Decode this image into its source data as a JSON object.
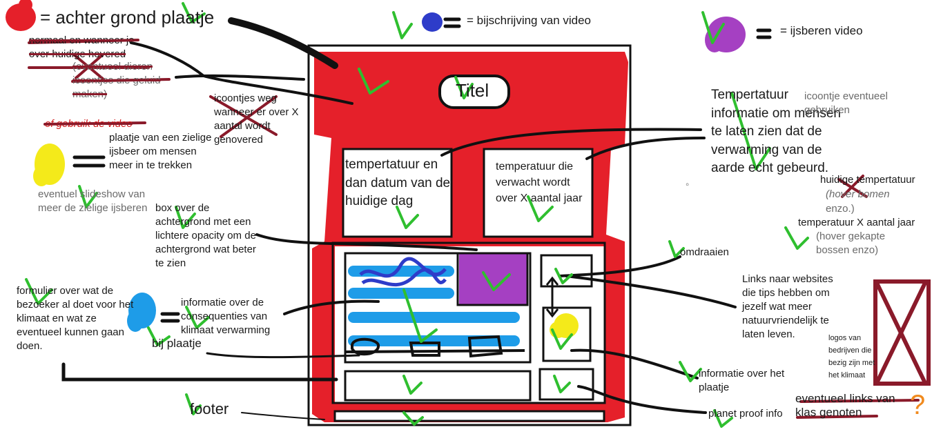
{
  "legend": {
    "background": "= achter grond plaatje",
    "caption": "= bijschrijving van video",
    "polar_video": "= ijsberen video",
    "sad_polar_image": "plaatje van een zielige ijsbeer om mensen meer in te trekken",
    "slideshow_note": "eventuel slideshow van meer de zielige ijsberen",
    "consequences_info": "informatie over de consequenties van klimaat verwarming",
    "with_image": "bij plaatje"
  },
  "struck_notes": {
    "hover_normal": "normaal en wanneer je over huidige hovered",
    "animal_icons": "(eventueel dieren icoontjes die geluid maken)",
    "use_video": "of gebruik de video",
    "icons_away": "icoontjes weg wanneer er over X aantal wordt genovered"
  },
  "annotations": {
    "box_over_background": "box over de achtergrond met een lichtere opacity om de achtergrond wat beter te zien",
    "form_note": "formulier over wat de bezoeker al doet voor het klimaat en wat ze eventueel kunnen gaan doen.",
    "footer": "footer",
    "temperature_info": "Tempertatuur informatie om mensen te laten zien dat de verwarming van de aarde echt gebeurd.",
    "icon_maybe": "icoontje eventueel gebruiken",
    "current_temp": "huidige tempertatuur",
    "hover_trees": "(hover bomen",
    "etc": "enzo.)",
    "temp_x_years": "temperatuur X aantal jaar",
    "hover_forests": "(hover gekapte bossen enzo)",
    "flip": "omdraaien",
    "links_tips": "Links naar websites die tips hebben om jezelf wat meer natuurvriendelijk te laten leven.",
    "logos_companies": "logos van bedrijven die bezig zijn met het klimaat",
    "image_info": "informatie over het plaatje",
    "planet_proof": "planet proof info",
    "links_class": "eventueel links van klas genoten",
    "question_mark": "?",
    "bullet": "◦"
  },
  "wireframe": {
    "title": "Titel",
    "box_today": "tempertatuur en dan datum van de huidige dag",
    "box_future": "temperatuur die verwacht wordt over X aantal jaar"
  },
  "colors": {
    "red": "#e5202a",
    "blue": "#2e3cc9",
    "purple": "#a540c2",
    "yellow": "#f4ea1a",
    "cyan": "#1e9ce8",
    "green": "#2fbf2f",
    "maroon": "#8a1a2a",
    "orange": "#f08a1e",
    "ink": "#111111"
  }
}
